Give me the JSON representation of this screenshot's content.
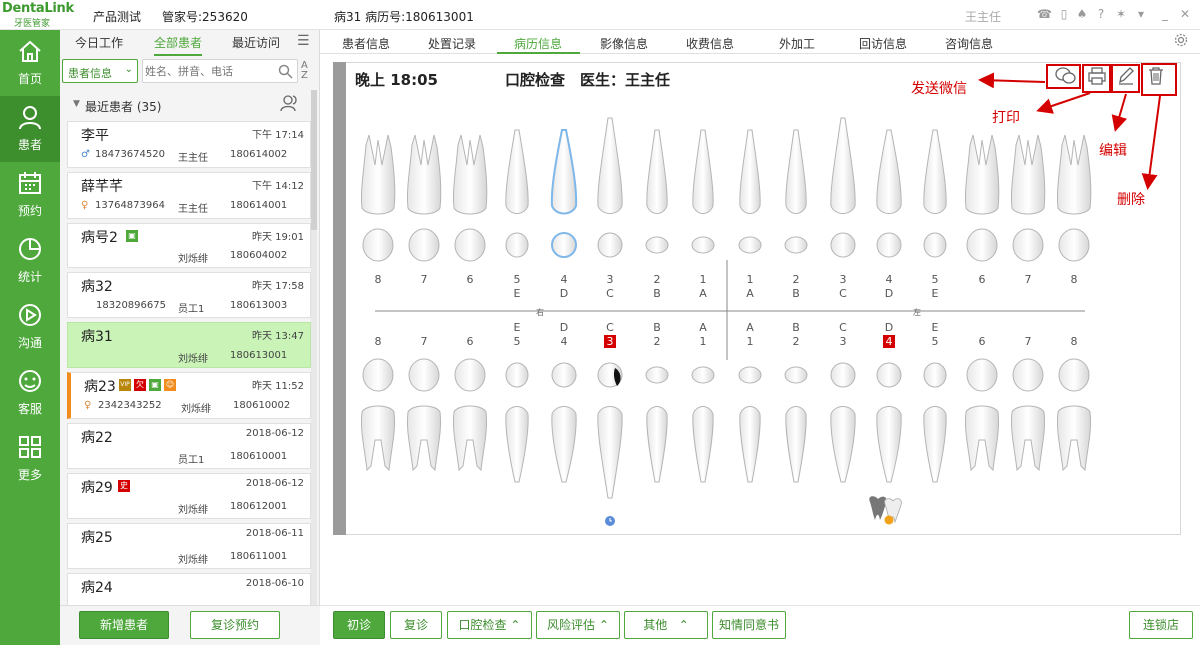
{
  "app": {
    "logo_main": "DentaLink",
    "logo_sub": "牙医管家",
    "product": "产品测试",
    "account": "管家号:253620",
    "patient_title": "病31  病历号:180613001",
    "user": "王主任"
  },
  "nav": [
    {
      "label": "首页",
      "icon": "home-icon"
    },
    {
      "label": "患者",
      "icon": "user-icon"
    },
    {
      "label": "预约",
      "icon": "calendar-icon"
    },
    {
      "label": "统计",
      "icon": "pie-chart-icon"
    },
    {
      "label": "沟通",
      "icon": "play-circle-icon"
    },
    {
      "label": "客服",
      "icon": "support-face-icon"
    },
    {
      "label": "更多",
      "icon": "grid-icon"
    }
  ],
  "left": {
    "tabs": [
      "今日工作",
      "全部患者",
      "最近访问"
    ],
    "filter_select": "患者信息",
    "search_placeholder": "姓名、拼音、电话",
    "recent_header": "最近患者 (35)",
    "patients": [
      {
        "name": "李平",
        "time": "下午 17:14",
        "phone": "18473674520",
        "doctor": "王主任",
        "id": "180614002"
      },
      {
        "name": "薛芊芊",
        "time": "下午 14:12",
        "phone": "13764873964",
        "doctor": "王主任",
        "id": "180614001"
      },
      {
        "name": "病号2",
        "time": "昨天 19:01",
        "phone": "",
        "doctor": "刘烁绯",
        "id": "180604002"
      },
      {
        "name": "病32",
        "time": "昨天 17:58",
        "phone": "18320896675",
        "doctor": "员工1",
        "id": "180613003"
      },
      {
        "name": "病31",
        "time": "昨天 13:47",
        "phone": "",
        "doctor": "刘烁绯",
        "id": "180613001"
      },
      {
        "name": "病23",
        "time": "昨天 11:52",
        "phone": "2342343252",
        "doctor": "刘烁绯",
        "id": "180610002"
      },
      {
        "name": "病22",
        "time": "2018-06-12",
        "phone": "",
        "doctor": "员工1",
        "id": "180610001"
      },
      {
        "name": "病29",
        "time": "2018-06-12",
        "phone": "",
        "doctor": "刘烁绯",
        "id": "180612001"
      },
      {
        "name": "病25",
        "time": "2018-06-11",
        "phone": "",
        "doctor": "刘烁绯",
        "id": "180611001"
      },
      {
        "name": "病24",
        "time": "2018-06-10",
        "phone": "",
        "doctor": "",
        "id": ""
      }
    ],
    "badges": {
      "vip": "VIP",
      "owe": "欠",
      "img": "▣",
      "face": "☺",
      "history": "史"
    },
    "btn_add": "新增患者",
    "btn_revisit": "复诊预约"
  },
  "main_tabs": [
    "患者信息",
    "处置记录",
    "病历信息",
    "影像信息",
    "收费信息",
    "外加工",
    "回访信息",
    "咨询信息"
  ],
  "record": {
    "time": "晚上 18:05",
    "exam": "口腔检查",
    "doctor": "医生：王主任",
    "upper_nums": [
      "8",
      "7",
      "6",
      "5",
      "4",
      "3",
      "2",
      "1",
      "1",
      "2",
      "3",
      "4",
      "5",
      "6",
      "7",
      "8"
    ],
    "upper_letters": [
      "",
      "",
      "",
      "E",
      "D",
      "C",
      "B",
      "A",
      "A",
      "B",
      "C",
      "D",
      "E",
      "",
      "",
      ""
    ],
    "lower_letters": [
      "",
      "",
      "",
      "E",
      "D",
      "C",
      "B",
      "A",
      "A",
      "B",
      "C",
      "D",
      "E",
      "",
      "",
      ""
    ],
    "lower_nums": [
      "8",
      "7",
      "6",
      "5",
      "4",
      "3",
      "2",
      "1",
      "1",
      "2",
      "3",
      "4",
      "5",
      "6",
      "7",
      "8"
    ],
    "side_right": "右",
    "side_left": "左"
  },
  "annotations": {
    "wechat": "发送微信",
    "print": "打印",
    "edit": "编辑",
    "delete": "删除"
  },
  "bottom": {
    "first": "初诊",
    "revisit": "复诊",
    "oral": "口腔检查",
    "risk": "风险评估",
    "other": "其他",
    "consent": "知情同意书",
    "chain": "连锁店"
  },
  "colors": {
    "brand": "#4ea83c",
    "brand_dark": "#3d8f2d",
    "alert": "#d40000",
    "active_card": "#c9f3b7"
  }
}
